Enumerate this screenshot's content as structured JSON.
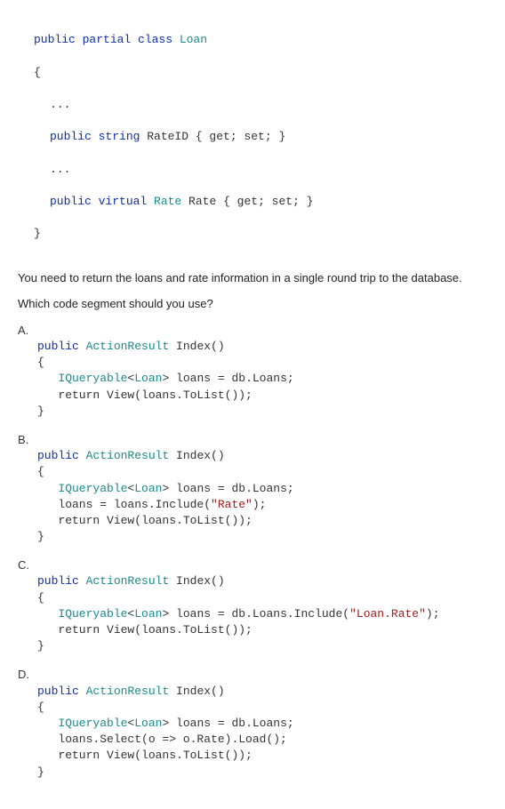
{
  "classDecl": {
    "line1_pre": "public partial class ",
    "className": "Loan",
    "brace_open": "{",
    "ellipsis1": "...",
    "rate_line_pre": "public string ",
    "rate_line_name": "RateID",
    "rate_line_post": " { get; set; }",
    "ellipsis2": "...",
    "virt_line_pre": "public virtual ",
    "virt_line_type": "Rate",
    "virt_line_name": " Rate",
    "virt_line_post": " { get; set; }",
    "brace_close": "}"
  },
  "prose1": "You need to return the loans and rate information in a single round trip to the database.",
  "prose2": "Which code segment should you use?",
  "options": {
    "A": {
      "label": "A.",
      "sig_pre": "public ",
      "sig_type": "ActionResult",
      "sig_post": " Index()",
      "l1": "{",
      "body": [
        {
          "pre": "",
          "t1": "IQueryable",
          "t2": "<",
          "t3": "Loan",
          "t4": "> loans = db.Loans;"
        },
        {
          "pre": "return View(loans.ToList());"
        }
      ],
      "l_close": "}"
    },
    "B": {
      "label": "B.",
      "sig_pre": "public ",
      "sig_type": "ActionResult",
      "sig_post": " Index()",
      "l1": "{",
      "body": [
        {
          "pre": "",
          "t1": "IQueryable",
          "t2": "<",
          "t3": "Loan",
          "t4": "> loans = db.Loans;"
        },
        {
          "pre": "loans = loans.Include(",
          "str": "\"Rate\"",
          "post": ");"
        },
        {
          "pre": "return View(loans.ToList());"
        }
      ],
      "l_close": "}"
    },
    "C": {
      "label": "C.",
      "sig_pre": "public ",
      "sig_type": "ActionResult",
      "sig_post": " Index()",
      "l1": "{",
      "body": [
        {
          "pre": "",
          "t1": "IQueryable",
          "t2": "<",
          "t3": "Loan",
          "t4": "> loans = db.Loans.Include(",
          "str": "\"Loan.Rate\"",
          "post": ");"
        },
        {
          "pre": "return View(loans.ToList());"
        }
      ],
      "l_close": "}"
    },
    "D": {
      "label": "D.",
      "sig_pre": "public ",
      "sig_type": "ActionResult",
      "sig_post": " Index()",
      "l1": "{",
      "body": [
        {
          "pre": "",
          "t1": "IQueryable",
          "t2": "<",
          "t3": "Loan",
          "t4": "> loans = db.Loans;"
        },
        {
          "pre": "loans.Select(o => o.Rate).Load();"
        },
        {
          "pre": "return View(loans.ToList());"
        }
      ],
      "l_close": "}"
    }
  }
}
